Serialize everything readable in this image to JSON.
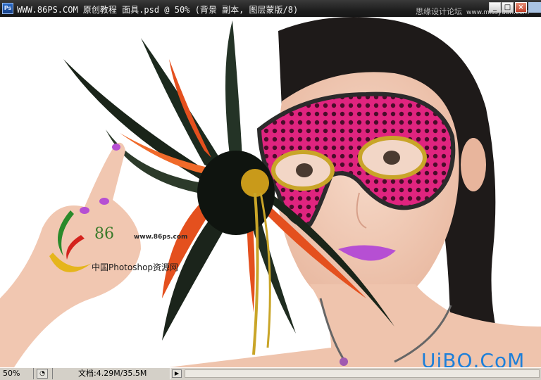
{
  "window": {
    "title": "WWW.86PS.COM 原创教程 面具.psd @ 50% (背景 副本, 图层蒙版/8)",
    "app_icon_label": "Ps",
    "site_tag": "思缘设计论坛",
    "site_tag_sub": "www.missyuan.com",
    "controls": {
      "minimize": "_",
      "maximize": "□",
      "close": "×"
    }
  },
  "canvas": {
    "watermark_logo_number": "86",
    "watermark_url": "www.86ps.com",
    "watermark_caption": "中国Photoshop资源网",
    "corner_watermark": "UiBQ.CoM"
  },
  "statusbar": {
    "zoom": "50%",
    "doc_info": "文档:4.29M/35.5M",
    "menu_arrow": "▶"
  },
  "colors": {
    "titlebar": "#1e1e1e",
    "mask_pink": "#d81a7a",
    "lips": "#b64fd3",
    "uibq": "#1d7fd9"
  }
}
